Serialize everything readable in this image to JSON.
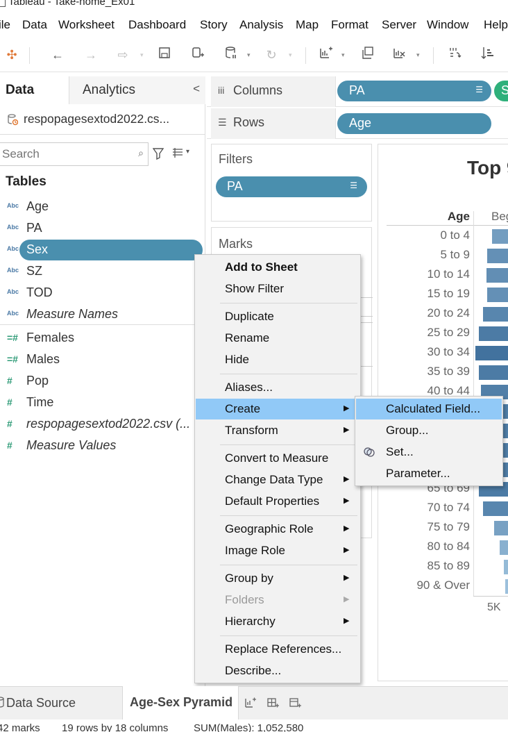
{
  "window": {
    "title": "Tableau - Take-home_Ex01"
  },
  "menubar": [
    "ile",
    "Data",
    "Worksheet",
    "Dashboard",
    "Story",
    "Analysis",
    "Map",
    "Format",
    "Server",
    "Window",
    "Help"
  ],
  "data_pane": {
    "tab_data": "Data",
    "tab_analytics": "Analytics",
    "collapse": "<",
    "datasource": "respopagesextod2022.cs...",
    "search_placeholder": "Search",
    "tables_heading": "Tables",
    "fields": [
      {
        "type": "Abc",
        "name": "Age"
      },
      {
        "type": "Abc",
        "name": "PA"
      },
      {
        "type": "Abc",
        "name": "Sex",
        "selected": true
      },
      {
        "type": "Abc",
        "name": "SZ"
      },
      {
        "type": "Abc",
        "name": "TOD"
      },
      {
        "type": "Abc",
        "name": "Measure Names",
        "italic": true
      },
      {
        "type": "=#",
        "name": "Females"
      },
      {
        "type": "=#",
        "name": "Males"
      },
      {
        "type": "#",
        "name": "Pop"
      },
      {
        "type": "#",
        "name": "Time"
      },
      {
        "type": "#",
        "name": "respopagesextod2022.csv (...",
        "italic": true
      },
      {
        "type": "#",
        "name": "Measure Values",
        "italic": true
      }
    ]
  },
  "shelves": {
    "columns_label": "Columns",
    "columns_pill": "PA",
    "columns_pill2": "S",
    "rows_label": "Rows",
    "rows_pill": "Age"
  },
  "filters": {
    "heading": "Filters",
    "pill": "PA"
  },
  "marks": {
    "heading": "Marks"
  },
  "viz": {
    "title": "Top 9",
    "age_header": "Age",
    "col_header": "Beg",
    "tick": "5K",
    "rows": [
      "0 to 4",
      "5 to 9",
      "10 to 14",
      "15 to 19",
      "20 to 24",
      "25 to 29",
      "30 to 34",
      "35 to 39",
      "40 to 44",
      "45 to 49",
      "50 to 54",
      "55 to 59",
      "60 to 64",
      "65 to 69",
      "70 to 74",
      "75 to 79",
      "80 to 84",
      "85 to 89",
      "90 & Over"
    ],
    "bar_levels": [
      0.45,
      0.6,
      0.62,
      0.6,
      0.72,
      0.85,
      0.95,
      0.85,
      0.8,
      0.8,
      0.8,
      0.8,
      0.8,
      0.85,
      0.72,
      0.4,
      0.22,
      0.1,
      0.03
    ],
    "colors": {
      "dark": "#3d6e9b",
      "light": "#9fc3de"
    }
  },
  "context_menu": {
    "items": [
      {
        "label": "Add to Sheet",
        "bold": true
      },
      {
        "label": "Show Filter"
      },
      {
        "label": "Duplicate"
      },
      {
        "label": "Rename"
      },
      {
        "label": "Hide"
      },
      {
        "label": "Aliases..."
      },
      {
        "label": "Create",
        "submenu": true,
        "highlighted": true
      },
      {
        "label": "Transform",
        "submenu": true
      },
      {
        "label": "Convert to Measure"
      },
      {
        "label": "Change Data Type",
        "submenu": true
      },
      {
        "label": "Default Properties",
        "submenu": true
      },
      {
        "label": "Geographic Role",
        "submenu": true
      },
      {
        "label": "Image Role",
        "submenu": true
      },
      {
        "label": "Group by",
        "submenu": true
      },
      {
        "label": "Folders",
        "submenu": true,
        "disabled": true
      },
      {
        "label": "Hierarchy",
        "submenu": true
      },
      {
        "label": "Replace References..."
      },
      {
        "label": "Describe..."
      }
    ],
    "highlight_color": "#91c9f7"
  },
  "submenu": {
    "items": [
      {
        "label": "Calculated Field...",
        "highlighted": true
      },
      {
        "label": "Group..."
      },
      {
        "label": "Set..."
      },
      {
        "label": "Parameter..."
      }
    ]
  },
  "bottom_tabs": {
    "data_source": "Data Source",
    "sheet": "Age-Sex Pyramid"
  },
  "status": {
    "marks": "42 marks",
    "rows_cols": "19 rows by 18 columns",
    "sum": "SUM(Males): 1,052,580"
  }
}
